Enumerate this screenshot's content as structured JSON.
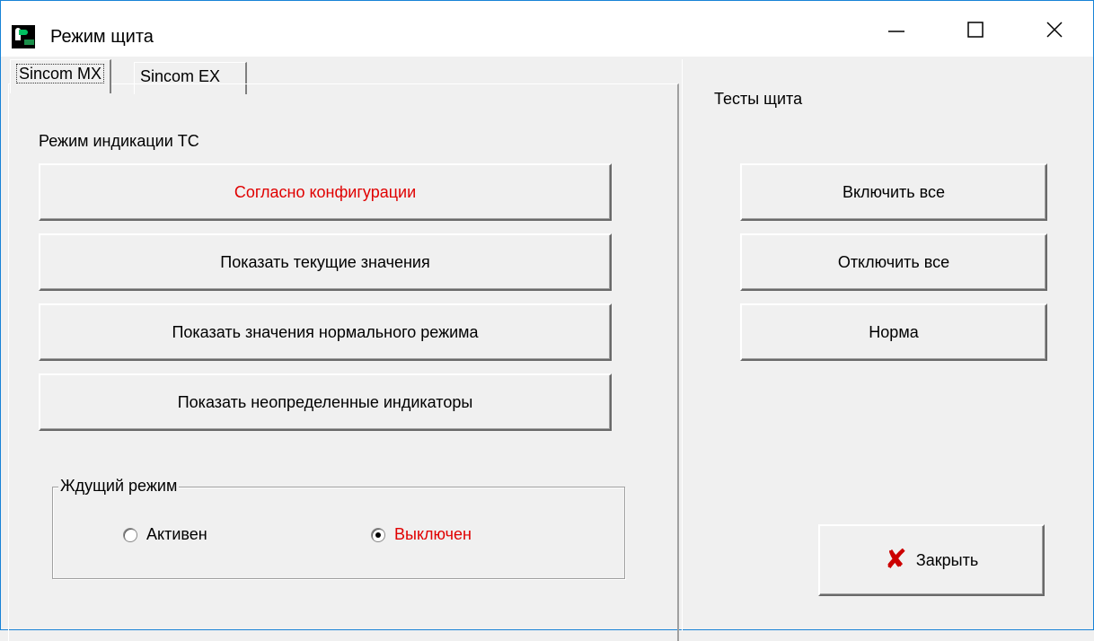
{
  "window": {
    "title": "Режим щита",
    "accent_color": "#1883d7"
  },
  "tabs": [
    {
      "label": "Sincom MX",
      "active": true
    },
    {
      "label": "Sincom EX",
      "active": false
    }
  ],
  "indication": {
    "label": "Режим индикации ТС",
    "buttons": [
      {
        "label": "Согласно конфигурации",
        "color": "#e00000"
      },
      {
        "label": "Показать текущие значения"
      },
      {
        "label": "Показать значения нормального режима"
      },
      {
        "label": "Показать неопределенные индикаторы"
      }
    ]
  },
  "standby": {
    "legend": "Ждущий режим",
    "options": [
      {
        "label": "Активен",
        "selected": false
      },
      {
        "label": "Выключен",
        "selected": true,
        "color": "#e00000"
      }
    ]
  },
  "tests": {
    "label": "Тесты щита",
    "buttons": [
      {
        "label": "Включить все"
      },
      {
        "label": "Отключить все"
      },
      {
        "label": "Норма"
      }
    ]
  },
  "close_button": {
    "label": "Закрыть",
    "icon": "x-mark-icon"
  },
  "title_controls": {
    "minimize_icon": "minimize-icon",
    "maximize_icon": "maximize-icon",
    "close_icon": "close-icon"
  }
}
